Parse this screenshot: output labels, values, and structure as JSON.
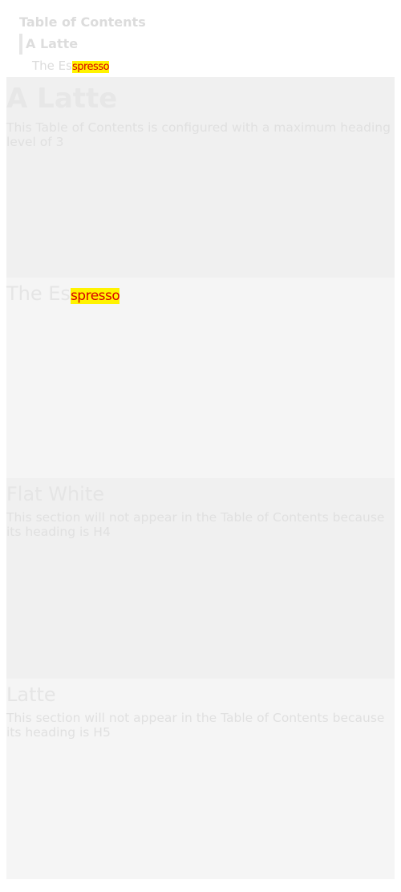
{
  "toc": {
    "title": "Table of Contents",
    "items": [
      {
        "label": "A Latte",
        "active": true
      },
      {
        "label_prefix": "The Es",
        "label_highlight": "spresso"
      }
    ]
  },
  "sections": [
    {
      "heading": "A Latte",
      "text": "This Table of Contents is configured with a maximum heading level of 3"
    },
    {
      "heading_prefix": "The Es",
      "heading_highlight": "spresso",
      "text": ""
    },
    {
      "heading": "Flat White",
      "text": "This section will not appear in the Table of Contents because its heading is H4"
    },
    {
      "heading": "Latte",
      "text": "This section will not appear in the Table of Contents because its heading is H5"
    }
  ],
  "colors": {
    "highlight_bg": "#fff300",
    "highlight_text": "#d80000"
  }
}
